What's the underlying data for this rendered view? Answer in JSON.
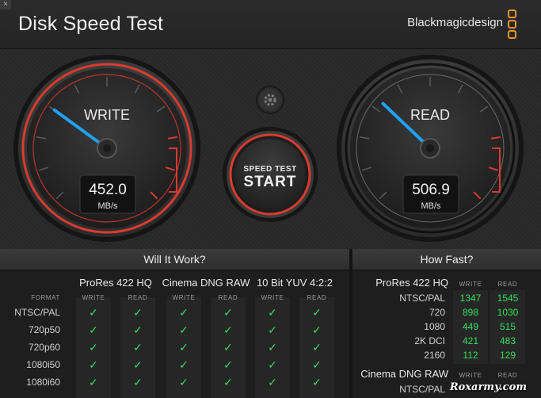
{
  "window": {
    "close_glyph": "×"
  },
  "app_title": "Disk Speed Test",
  "brand": {
    "name": "Blackmagicdesign",
    "logo_icon": "blackmagic-logo-icon"
  },
  "gauges": {
    "write": {
      "label": "WRITE",
      "value": "452.0",
      "unit": "MB/s",
      "speed": 452.0
    },
    "read": {
      "label": "READ",
      "value": "506.9",
      "unit": "MB/s",
      "speed": 506.9
    },
    "settings_icon": "gear-icon",
    "start": {
      "line1": "SPEED TEST",
      "line2": "START"
    }
  },
  "colors": {
    "accent_red": "#d93b2e",
    "needle_blue": "#1fa2ff",
    "check_green": "#32e05a",
    "brand_orange": "#e8952c"
  },
  "will_it_work": {
    "title": "Will It Work?",
    "format_label": "FORMAT",
    "codecs": [
      {
        "name": "ProRes 422 HQ",
        "write": "WRITE",
        "read": "READ"
      },
      {
        "name": "Cinema DNG RAW",
        "write": "WRITE",
        "read": "READ"
      },
      {
        "name": "10 Bit YUV 4:2:2",
        "write": "WRITE",
        "read": "READ"
      }
    ],
    "rows": [
      {
        "format": "NTSC/PAL",
        "checks": [
          "✓",
          "✓",
          "✓",
          "✓",
          "✓",
          "✓"
        ]
      },
      {
        "format": "720p50",
        "checks": [
          "✓",
          "✓",
          "✓",
          "✓",
          "✓",
          "✓"
        ]
      },
      {
        "format": "720p60",
        "checks": [
          "✓",
          "✓",
          "✓",
          "✓",
          "✓",
          "✓"
        ]
      },
      {
        "format": "1080i50",
        "checks": [
          "✓",
          "✓",
          "✓",
          "✓",
          "✓",
          "✓"
        ]
      },
      {
        "format": "1080i60",
        "checks": [
          "✓",
          "✓",
          "✓",
          "✓",
          "✓",
          "✓"
        ]
      }
    ]
  },
  "how_fast": {
    "title": "How Fast?",
    "groups": [
      {
        "codec": "ProRes 422 HQ",
        "write": "WRITE",
        "read": "READ",
        "rows": [
          {
            "format": "NTSC/PAL",
            "write": "1347",
            "read": "1545"
          },
          {
            "format": "720",
            "write": "898",
            "read": "1030"
          },
          {
            "format": "1080",
            "write": "449",
            "read": "515"
          },
          {
            "format": "2K DCI",
            "write": "421",
            "read": "483"
          },
          {
            "format": "2160",
            "write": "112",
            "read": "129"
          }
        ]
      },
      {
        "codec": "Cinema DNG RAW",
        "write": "WRITE",
        "read": "READ",
        "rows": [
          {
            "format": "NTSC/PAL",
            "write": "",
            "read": ""
          }
        ]
      }
    ]
  },
  "watermark": "Roxarmy.com"
}
